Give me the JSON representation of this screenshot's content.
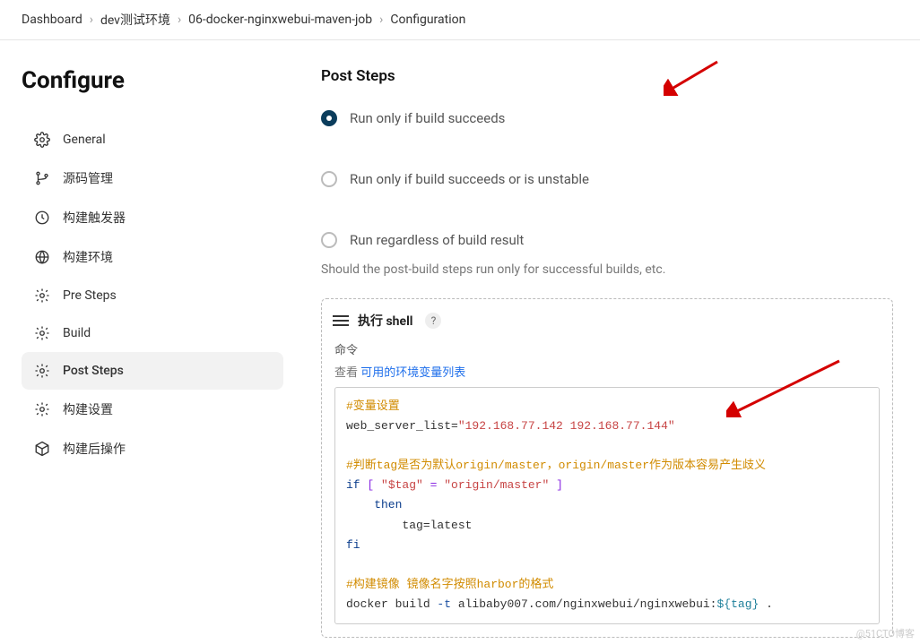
{
  "breadcrumb": {
    "dashboard": "Dashboard",
    "env": "dev测试环境",
    "job": "06-docker-nginxwebui-maven-job",
    "page": "Configuration"
  },
  "sidebar": {
    "title": "Configure",
    "items": [
      {
        "label": "General"
      },
      {
        "label": "源码管理"
      },
      {
        "label": "构建触发器"
      },
      {
        "label": "构建环境"
      },
      {
        "label": "Pre Steps"
      },
      {
        "label": "Build"
      },
      {
        "label": "Post Steps"
      },
      {
        "label": "构建设置"
      },
      {
        "label": "构建后操作"
      }
    ]
  },
  "main": {
    "heading": "Post Steps",
    "radios": {
      "opt1": "Run only if build succeeds",
      "opt2": "Run only if build succeeds or is unstable",
      "opt3": "Run regardless of build result"
    },
    "help": "Should the post-build steps run only for successful builds, etc.",
    "step": {
      "title": "执行 shell",
      "field": "命令",
      "env_prefix": "查看 ",
      "env_link": "可用的环境变量列表",
      "code": {
        "c1": "#变量设置",
        "l2a": "web_server_list=",
        "l2b": "\"192.168.77.142 192.168.77.144\"",
        "c3": "#判断tag是否为默认origin/master，origin/master作为版本容易产生歧义",
        "l4a": "if ",
        "l4b": "[",
        "l4c": " \"$tag\" ",
        "l4d": "=",
        "l4e": " \"origin/master\" ",
        "l4f": "]",
        "l5a": "    then",
        "l6a": "        tag=latest",
        "l7a": "fi",
        "c8": "#构建镜像 镜像名字按照harbor的格式",
        "l9a": "docker build ",
        "l9b": "-t",
        "l9c": " alibaby007.com/nginxwebui/nginxwebui:",
        "l9d": "${tag}",
        "l9e": " ."
      }
    }
  },
  "watermark": "@51CTO博客"
}
